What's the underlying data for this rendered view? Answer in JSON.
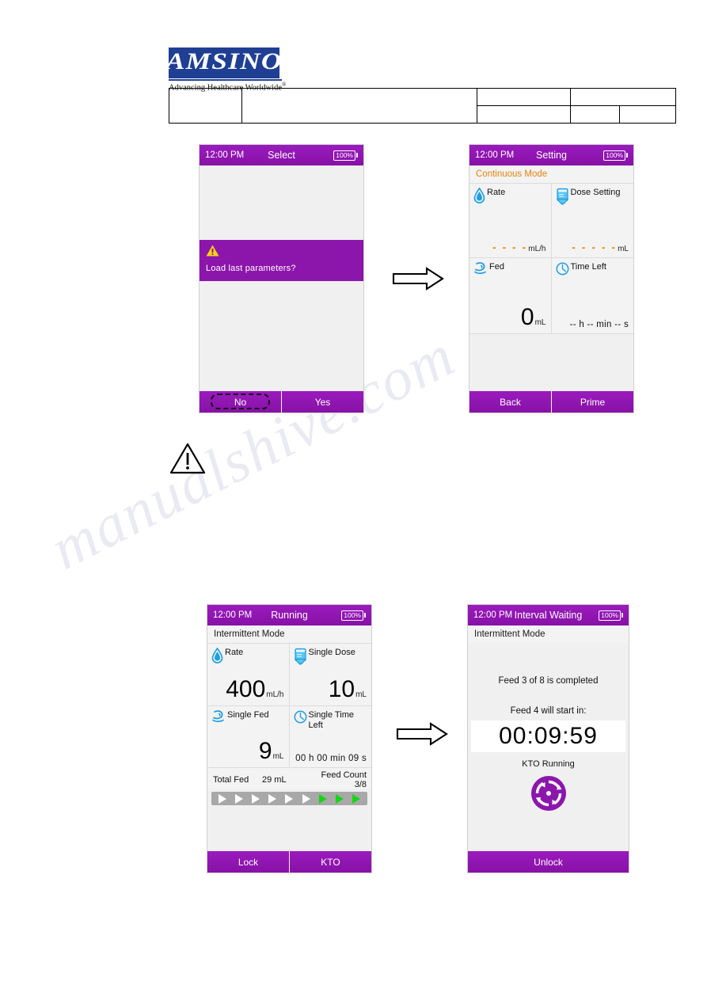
{
  "brand": {
    "logo_text": "AMSINO",
    "tagline": "Advancing Healthcare Worldwide",
    "tagline_mark": "®",
    "logo_color": "#1f3f93"
  },
  "watermark": {
    "text": "manualshive.com"
  },
  "theme": {
    "purple": "#8c16ab",
    "orange": "#e8820c",
    "green": "#16d516",
    "blue_icon": "#1f9ede",
    "screen_bg": "#f0f0f0"
  },
  "screens": [
    {
      "id": "select",
      "time": "12:00 PM",
      "title": "Select",
      "battery": "100%",
      "dialog": {
        "icon": "warning-triangle-icon",
        "message": "Load last parameters?"
      },
      "buttons": [
        {
          "label": "No",
          "focused": true
        },
        {
          "label": "Yes",
          "focused": false
        }
      ]
    },
    {
      "id": "setting",
      "time": "12:00 PM",
      "title": "Setting",
      "battery": "100%",
      "mode": "Continuous Mode",
      "cells": [
        {
          "icon": "droplet-icon",
          "label": "Rate",
          "value": "- - - -",
          "unit": "mL/h",
          "value_style": "dashes"
        },
        {
          "icon": "feeding-bag-icon",
          "label": "Dose Setting",
          "value": "- - - - -",
          "unit": "mL",
          "value_style": "dashes"
        },
        {
          "icon": "stomach-icon",
          "label": "Fed",
          "value": "0",
          "unit": "mL",
          "value_style": "big"
        },
        {
          "icon": "clock-icon",
          "label": "Time Left",
          "value": "-- h -- min -- s",
          "unit": "",
          "value_style": "time"
        }
      ],
      "buttons": [
        {
          "label": "Back",
          "focused": false
        },
        {
          "label": "Prime",
          "focused": false
        }
      ]
    },
    {
      "id": "running",
      "time": "12:00 PM",
      "title": "Running",
      "battery": "100%",
      "mode": "Intermittent Mode",
      "cells": [
        {
          "icon": "droplet-icon",
          "label": "Rate",
          "value": "400",
          "unit": "mL/h",
          "value_style": "big"
        },
        {
          "icon": "feeding-bag-icon",
          "label": "Single Dose",
          "value": "10",
          "unit": "mL",
          "value_style": "big"
        },
        {
          "icon": "stomach-icon",
          "label": "Single Fed",
          "value": "9",
          "unit": "mL",
          "value_style": "big"
        },
        {
          "icon": "clock-icon",
          "label": "Single Time Left",
          "value": "00 h 00 min 09 s",
          "unit": "",
          "value_style": "time"
        }
      ],
      "totals": {
        "total_fed_label": "Total Fed",
        "total_fed_value": "29 mL",
        "feed_count_label": "Feed Count",
        "feed_count_value": "3/8"
      },
      "progress": {
        "total_segments": 9,
        "completed_segments": 3
      },
      "buttons": [
        {
          "label": "Lock",
          "focused": false
        },
        {
          "label": "KTO",
          "focused": false
        }
      ]
    },
    {
      "id": "interval-waiting",
      "time": "12:00 PM",
      "title": "Interval Waiting",
      "battery": "100%",
      "mode": "Intermittent Mode",
      "line1": "Feed 3 of 8 is completed",
      "line2": "Feed 4 will start in:",
      "timer": "00:09:59",
      "status": "KTO Running",
      "status_icon": "kto-rotation-icon",
      "buttons": [
        {
          "label": "Unlock",
          "focused": false
        }
      ]
    }
  ],
  "flow_arrows": [
    {
      "name": "flow-arrow-top"
    },
    {
      "name": "flow-arrow-bottom"
    }
  ],
  "standalone_warning": {
    "icon": "warning-triangle-outline-icon"
  }
}
